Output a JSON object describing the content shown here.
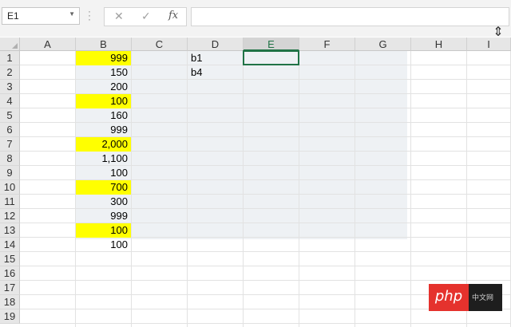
{
  "formula_bar": {
    "name_box": "E1",
    "formula": "",
    "cancel_icon": "✕",
    "enter_icon": "✓",
    "fx_label": "fx"
  },
  "columns": [
    "A",
    "B",
    "C",
    "D",
    "E",
    "F",
    "G",
    "H",
    "I"
  ],
  "rows": [
    "1",
    "2",
    "3",
    "4",
    "5",
    "6",
    "7",
    "8",
    "9",
    "10",
    "11",
    "12",
    "13",
    "14",
    "15",
    "16",
    "17",
    "18",
    "19"
  ],
  "column_b": [
    {
      "row": 1,
      "value": "999",
      "highlight": true
    },
    {
      "row": 2,
      "value": "150",
      "highlight": false
    },
    {
      "row": 3,
      "value": "200",
      "highlight": false
    },
    {
      "row": 4,
      "value": "100",
      "highlight": true
    },
    {
      "row": 5,
      "value": "160",
      "highlight": false
    },
    {
      "row": 6,
      "value": "999",
      "highlight": false
    },
    {
      "row": 7,
      "value": "2,000",
      "highlight": true
    },
    {
      "row": 8,
      "value": "1,100",
      "highlight": false
    },
    {
      "row": 9,
      "value": "100",
      "highlight": false
    },
    {
      "row": 10,
      "value": "700",
      "highlight": true
    },
    {
      "row": 11,
      "value": "300",
      "highlight": false
    },
    {
      "row": 12,
      "value": "999",
      "highlight": false
    },
    {
      "row": 13,
      "value": "100",
      "highlight": true
    },
    {
      "row": 14,
      "value": "100",
      "highlight": false
    }
  ],
  "column_d": [
    {
      "row": 1,
      "value": "b1"
    },
    {
      "row": 2,
      "value": "b4"
    }
  ],
  "selected_column": "E",
  "active_cell": "E1",
  "colors": {
    "highlight": "#ffff00",
    "accent": "#217346",
    "region": "#eef1f4"
  },
  "watermark": {
    "brand": "php",
    "suffix": "中文网"
  }
}
